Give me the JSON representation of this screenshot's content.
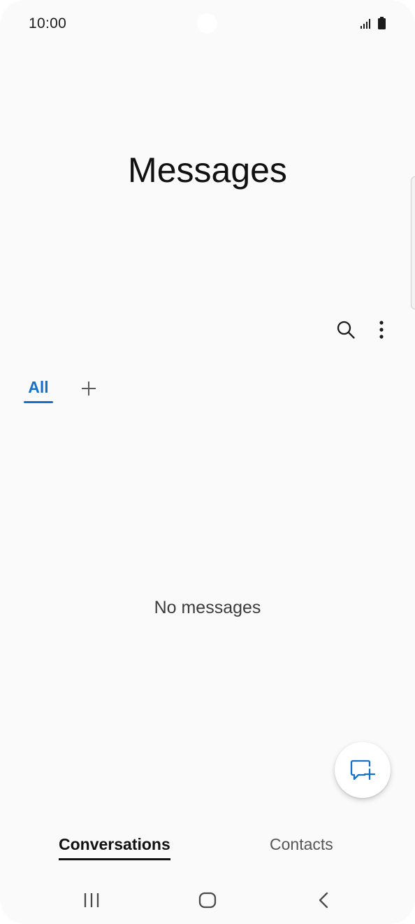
{
  "status_bar": {
    "time": "10:00",
    "icons": [
      "signal-icon",
      "battery-icon"
    ]
  },
  "header": {
    "title": "Messages"
  },
  "toolbar": {
    "icons": [
      "search-icon",
      "more-vertical-icon"
    ]
  },
  "filter_tabs": {
    "items": [
      {
        "label": "All",
        "selected": true
      }
    ],
    "add_icon": "plus-icon"
  },
  "main": {
    "empty_text": "No messages"
  },
  "fab": {
    "icon": "new-message-icon"
  },
  "bottom_tabs": {
    "items": [
      {
        "label": "Conversations",
        "selected": true
      },
      {
        "label": "Contacts",
        "selected": false
      }
    ]
  },
  "nav_bar": {
    "icons": [
      "recents-icon",
      "home-icon",
      "back-icon"
    ]
  },
  "colors": {
    "accent": "#1670c8",
    "background": "#fafafa",
    "text_primary": "#111111",
    "text_secondary": "#555555"
  }
}
